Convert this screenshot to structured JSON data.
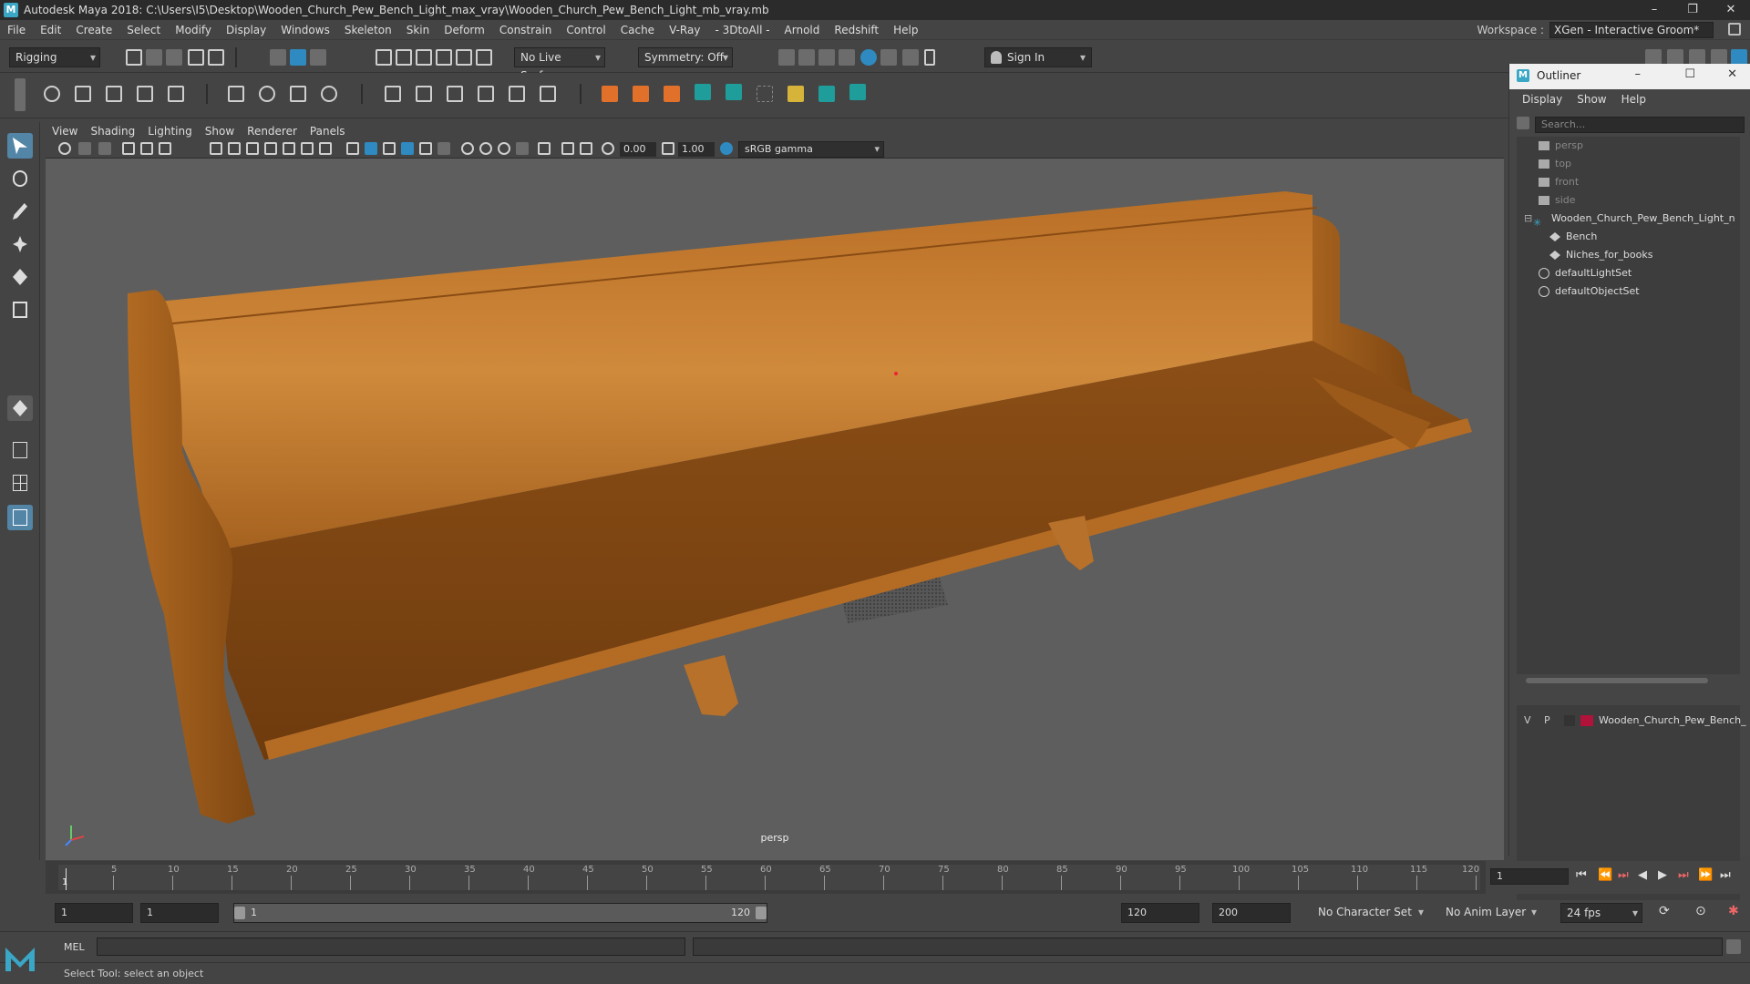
{
  "window": {
    "title": "Autodesk Maya 2018: C:\\Users\\I5\\Desktop\\Wooden_Church_Pew_Bench_Light_max_vray\\Wooden_Church_Pew_Bench_Light_mb_vray.mb",
    "controls": [
      "–",
      "❐",
      "✕"
    ]
  },
  "menubar": {
    "items": [
      "File",
      "Edit",
      "Create",
      "Select",
      "Modify",
      "Display",
      "Windows",
      "Skeleton",
      "Skin",
      "Deform",
      "Constrain",
      "Control",
      "Cache",
      "V-Ray",
      "- 3DtoAll -",
      "Arnold",
      "Redshift",
      "Help"
    ],
    "workspace_label": "Workspace :",
    "workspace_value": "XGen - Interactive Groom*"
  },
  "statusline": {
    "mode": "Rigging",
    "live_surface": "No Live Surface",
    "symmetry": "Symmetry: Off",
    "sign_in": "Sign In"
  },
  "panel": {
    "menus": [
      "View",
      "Shading",
      "Lighting",
      "Show",
      "Renderer",
      "Panels"
    ],
    "exposure": "0.00",
    "gamma": "1.00",
    "colorspace": "sRGB gamma",
    "camera": "persp"
  },
  "outliner": {
    "title": "Outliner",
    "menus": [
      "Display",
      "Show",
      "Help"
    ],
    "search_placeholder": "Search...",
    "items": [
      {
        "label": "persp",
        "kind": "camera",
        "depth": 1
      },
      {
        "label": "top",
        "kind": "camera",
        "depth": 1
      },
      {
        "label": "front",
        "kind": "camera",
        "depth": 1
      },
      {
        "label": "side",
        "kind": "camera",
        "depth": 1
      },
      {
        "label": "Wooden_Church_Pew_Bench_Light_n",
        "kind": "group",
        "depth": 1
      },
      {
        "label": "Bench",
        "kind": "mesh",
        "depth": 2
      },
      {
        "label": "Niches_for_books",
        "kind": "mesh",
        "depth": 2
      },
      {
        "label": "defaultLightSet",
        "kind": "set",
        "depth": 1
      },
      {
        "label": "defaultObjectSet",
        "kind": "set",
        "depth": 1
      }
    ]
  },
  "layer": {
    "v": "V",
    "p": "P",
    "name": "Wooden_Church_Pew_Bench_",
    "color": "#b0123a"
  },
  "timeline": {
    "ticks": [
      "1",
      "5",
      "10",
      "15",
      "20",
      "25",
      "30",
      "35",
      "40",
      "45",
      "50",
      "55",
      "60",
      "65",
      "70",
      "75",
      "80",
      "85",
      "90",
      "95",
      "100",
      "105",
      "110",
      "115",
      "120"
    ],
    "current_frame": "1"
  },
  "range": {
    "start": "1",
    "playback_start": "1",
    "slider_start": "1",
    "slider_end": "120",
    "playback_end": "120",
    "end": "200",
    "character_set": "No Character Set",
    "anim_layer": "No Anim Layer",
    "fps": "24 fps"
  },
  "commandline": {
    "label": "MEL"
  },
  "helpline": {
    "text": "Select Tool: select an object"
  }
}
